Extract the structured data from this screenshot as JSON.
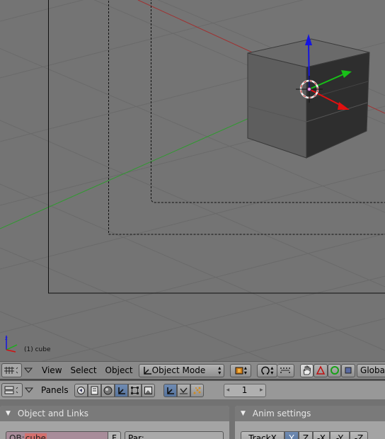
{
  "viewport": {
    "object_label": "(1) cube"
  },
  "header_3d": {
    "view_menu": "View",
    "select_menu": "Select",
    "object_menu": "Object",
    "mode_value": "Object Mode",
    "orientation_value": "Globa"
  },
  "header_buttons": {
    "panels_label": "Panels",
    "frame_value": "1"
  },
  "object_links_panel": {
    "title": "Object and Links",
    "ob_prefix": "OB:",
    "ob_value": "cube",
    "f_label": "F",
    "par_label": "Par:"
  },
  "anim_panel": {
    "title": "Anim settings",
    "track_buttons": [
      "TrackX",
      "Y",
      "Z",
      "-X",
      "-Y",
      "-Z"
    ],
    "active_track": "Y"
  },
  "colors": {
    "x_axis": "#d01010",
    "y_axis": "#10b010",
    "z_axis": "#1010e0",
    "active": "#5a7aa6"
  }
}
